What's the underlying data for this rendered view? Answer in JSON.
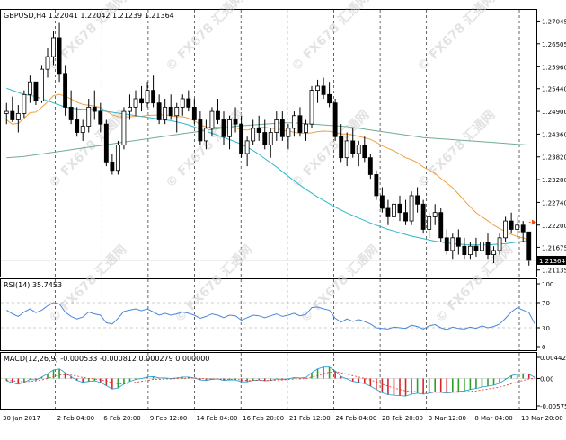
{
  "chart_data": {
    "type": "candlestick",
    "main": {
      "label": "GBPUSD,H4 1.22041 1.22042 1.21239 1.21364",
      "y_ticks": [
        1.27045,
        1.26505,
        1.2596,
        1.2544,
        1.249,
        1.2436,
        1.2382,
        1.2328,
        1.2274,
        1.222,
        1.21675,
        1.21135
      ],
      "ylim": [
        1.2098,
        1.2731
      ],
      "last_price_label": "1.21364",
      "last_price": 1.21364,
      "arrow_level": 1.2227,
      "ohlc": [
        [
          1.2485,
          1.251,
          1.246,
          1.249
        ],
        [
          1.249,
          1.2525,
          1.2465,
          1.247
        ],
        [
          1.247,
          1.2505,
          1.244,
          1.2485
        ],
        [
          1.2485,
          1.254,
          1.2475,
          1.253
        ],
        [
          1.253,
          1.2575,
          1.251,
          1.256
        ],
        [
          1.256,
          1.256,
          1.2505,
          1.2515
        ],
        [
          1.2515,
          1.26,
          1.251,
          1.259
        ],
        [
          1.259,
          1.264,
          1.257,
          1.262
        ],
        [
          1.262,
          1.268,
          1.26,
          1.2665
        ],
        [
          1.2665,
          1.27,
          1.256,
          1.258
        ],
        [
          1.258,
          1.26,
          1.248,
          1.25
        ],
        [
          1.25,
          1.254,
          1.246,
          1.247
        ],
        [
          1.247,
          1.25,
          1.243,
          1.244
        ],
        [
          1.244,
          1.247,
          1.242,
          1.2455
        ],
        [
          1.2455,
          1.252,
          1.244,
          1.25
        ],
        [
          1.25,
          1.254,
          1.247,
          1.249
        ],
        [
          1.249,
          1.251,
          1.244,
          1.246
        ],
        [
          1.246,
          1.247,
          1.236,
          1.237
        ],
        [
          1.237,
          1.239,
          1.234,
          1.235
        ],
        [
          1.235,
          1.242,
          1.234,
          1.241
        ],
        [
          1.241,
          1.25,
          1.24,
          1.249
        ],
        [
          1.249,
          1.253,
          1.247,
          1.25
        ],
        [
          1.25,
          1.254,
          1.248,
          1.252
        ],
        [
          1.252,
          1.255,
          1.249,
          1.251
        ],
        [
          1.251,
          1.256,
          1.25,
          1.254
        ],
        [
          1.254,
          1.2575,
          1.25,
          1.251
        ],
        [
          1.251,
          1.253,
          1.246,
          1.247
        ],
        [
          1.247,
          1.252,
          1.246,
          1.25
        ],
        [
          1.25,
          1.253,
          1.247,
          1.248
        ],
        [
          1.248,
          1.251,
          1.244,
          1.25
        ],
        [
          1.25,
          1.253,
          1.248,
          1.252
        ],
        [
          1.252,
          1.254,
          1.249,
          1.25
        ],
        [
          1.25,
          1.252,
          1.246,
          1.247
        ],
        [
          1.247,
          1.249,
          1.241,
          1.242
        ],
        [
          1.242,
          1.247,
          1.24,
          1.245
        ],
        [
          1.245,
          1.25,
          1.243,
          1.249
        ],
        [
          1.249,
          1.252,
          1.246,
          1.247
        ],
        [
          1.247,
          1.249,
          1.241,
          1.243
        ],
        [
          1.243,
          1.248,
          1.24,
          1.247
        ],
        [
          1.247,
          1.25,
          1.244,
          1.246
        ],
        [
          1.246,
          1.248,
          1.238,
          1.239
        ],
        [
          1.239,
          1.243,
          1.236,
          1.242
        ],
        [
          1.242,
          1.247,
          1.241,
          1.245
        ],
        [
          1.245,
          1.248,
          1.242,
          1.244
        ],
        [
          1.244,
          1.247,
          1.24,
          1.241
        ],
        [
          1.241,
          1.245,
          1.238,
          1.244
        ],
        [
          1.244,
          1.249,
          1.242,
          1.247
        ],
        [
          1.247,
          1.249,
          1.242,
          1.243
        ],
        [
          1.243,
          1.246,
          1.24,
          1.245
        ],
        [
          1.245,
          1.249,
          1.243,
          1.248
        ],
        [
          1.248,
          1.25,
          1.243,
          1.244
        ],
        [
          1.244,
          1.247,
          1.242,
          1.246
        ],
        [
          1.246,
          1.255,
          1.245,
          1.254
        ],
        [
          1.254,
          1.2565,
          1.251,
          1.255
        ],
        [
          1.255,
          1.257,
          1.252,
          1.253
        ],
        [
          1.253,
          1.256,
          1.25,
          1.251
        ],
        [
          1.251,
          1.252,
          1.242,
          1.243
        ],
        [
          1.243,
          1.246,
          1.237,
          1.238
        ],
        [
          1.238,
          1.244,
          1.236,
          1.242
        ],
        [
          1.242,
          1.245,
          1.238,
          1.239
        ],
        [
          1.239,
          1.242,
          1.236,
          1.241
        ],
        [
          1.241,
          1.243,
          1.237,
          1.238
        ],
        [
          1.238,
          1.239,
          1.233,
          1.234
        ],
        [
          1.234,
          1.235,
          1.228,
          1.229
        ],
        [
          1.229,
          1.231,
          1.225,
          1.226
        ],
        [
          1.226,
          1.228,
          1.222,
          1.224
        ],
        [
          1.224,
          1.228,
          1.223,
          1.227
        ],
        [
          1.227,
          1.229,
          1.223,
          1.225
        ],
        [
          1.225,
          1.228,
          1.222,
          1.223
        ],
        [
          1.223,
          1.23,
          1.222,
          1.229
        ],
        [
          1.229,
          1.231,
          1.225,
          1.227
        ],
        [
          1.227,
          1.228,
          1.22,
          1.221
        ],
        [
          1.221,
          1.225,
          1.219,
          1.224
        ],
        [
          1.224,
          1.227,
          1.222,
          1.225
        ],
        [
          1.225,
          1.226,
          1.218,
          1.219
        ],
        [
          1.219,
          1.221,
          1.215,
          1.216
        ],
        [
          1.216,
          1.22,
          1.214,
          1.219
        ],
        [
          1.219,
          1.221,
          1.215,
          1.217
        ],
        [
          1.217,
          1.219,
          1.214,
          1.215
        ],
        [
          1.215,
          1.218,
          1.214,
          1.217
        ],
        [
          1.217,
          1.219,
          1.2145,
          1.216
        ],
        [
          1.216,
          1.219,
          1.215,
          1.218
        ],
        [
          1.218,
          1.22,
          1.214,
          1.215
        ],
        [
          1.215,
          1.217,
          1.213,
          1.216
        ],
        [
          1.216,
          1.22,
          1.215,
          1.219
        ],
        [
          1.219,
          1.224,
          1.218,
          1.223
        ],
        [
          1.223,
          1.225,
          1.22,
          1.221
        ],
        [
          1.221,
          1.224,
          1.219,
          1.222
        ],
        [
          1.222,
          1.223,
          1.218,
          1.2204
        ],
        [
          1.2204,
          1.2204,
          1.2124,
          1.2136
        ]
      ],
      "ma_fast": [
        1.2545,
        1.254,
        1.2535,
        1.253,
        1.2528,
        1.2525,
        1.252,
        1.2515,
        1.251,
        1.2505,
        1.25,
        1.2498,
        1.2496,
        1.2495,
        1.2495,
        1.2494,
        1.2492,
        1.249,
        1.2488,
        1.2486,
        1.2484,
        1.2482,
        1.248,
        1.2478,
        1.2476,
        1.2474,
        1.2472,
        1.247,
        1.2468,
        1.2465,
        1.2462,
        1.2458,
        1.2453,
        1.2448,
        1.2443,
        1.2438,
        1.2433,
        1.2428,
        1.2423,
        1.2418,
        1.2412,
        1.2405,
        1.2397,
        1.2388,
        1.2378,
        1.2368,
        1.2358,
        1.2347,
        1.2336,
        1.2325,
        1.2315,
        1.2305,
        1.2296,
        1.2287,
        1.2279,
        1.2271,
        1.2263,
        1.2256,
        1.2249,
        1.2243,
        1.2237,
        1.2231,
        1.2225,
        1.222,
        1.2215,
        1.221,
        1.2206,
        1.2202,
        1.2198,
        1.2194,
        1.2191,
        1.2188,
        1.2185,
        1.2182,
        1.218,
        1.2178,
        1.2176,
        1.2175,
        1.2174,
        1.2173,
        1.2173,
        1.2173,
        1.2173,
        1.2174,
        1.2175,
        1.2176,
        1.2178,
        1.218,
        1.2182,
        1.2184
      ],
      "ma_slow": [
        1.238,
        1.2381,
        1.2382,
        1.2383,
        1.2385,
        1.2387,
        1.2389,
        1.2391,
        1.2393,
        1.2395,
        1.2397,
        1.2399,
        1.2401,
        1.2403,
        1.2405,
        1.2407,
        1.2409,
        1.2411,
        1.2413,
        1.2415,
        1.2417,
        1.2419,
        1.2421,
        1.2423,
        1.2425,
        1.2427,
        1.2429,
        1.2431,
        1.2433,
        1.2435,
        1.2437,
        1.2439,
        1.2441,
        1.2443,
        1.2445,
        1.2447,
        1.2449,
        1.2451,
        1.2453,
        1.2455,
        1.2456,
        1.2457,
        1.2458,
        1.2459,
        1.246,
        1.2461,
        1.2462,
        1.2463,
        1.2463,
        1.2463,
        1.2462,
        1.2461,
        1.246,
        1.2459,
        1.2458,
        1.2457,
        1.2456,
        1.2455,
        1.2454,
        1.2452,
        1.245,
        1.2448,
        1.2446,
        1.2444,
        1.2442,
        1.244,
        1.2438,
        1.2436,
        1.2434,
        1.2432,
        1.243,
        1.2428,
        1.2427,
        1.2426,
        1.2425,
        1.2424,
        1.2423,
        1.2422,
        1.2421,
        1.242,
        1.2419,
        1.2418,
        1.2417,
        1.2416,
        1.2415,
        1.2414,
        1.2413,
        1.2412,
        1.2411,
        1.241
      ]
    },
    "rsi": {
      "label": "RSI(14) 35.7453",
      "ylim": [
        0,
        100
      ],
      "ticks": [
        100,
        70,
        30,
        0
      ],
      "levels": [
        70,
        30
      ],
      "values": [
        58,
        52,
        48,
        55,
        60,
        54,
        58,
        65,
        70,
        68,
        55,
        48,
        44,
        47,
        55,
        52,
        50,
        38,
        36,
        45,
        56,
        58,
        60,
        57,
        60,
        55,
        50,
        53,
        50,
        52,
        55,
        53,
        50,
        45,
        48,
        52,
        50,
        46,
        50,
        49,
        42,
        46,
        50,
        49,
        46,
        49,
        52,
        48,
        50,
        53,
        49,
        51,
        62,
        63,
        60,
        58,
        45,
        39,
        44,
        40,
        43,
        40,
        36,
        30,
        29,
        28,
        31,
        30,
        29,
        34,
        32,
        28,
        33,
        35,
        30,
        27,
        31,
        29,
        28,
        31,
        29,
        33,
        30,
        32,
        36,
        45,
        55,
        62,
        58,
        54,
        36
      ]
    },
    "macd": {
      "label": "MACD(12,26,9) -0.000533 -0.000812 0.000279 0.000000",
      "ylim": [
        -0.00575,
        0.00442
      ],
      "ticks": [
        0.00442,
        0.0,
        -0.00575
      ],
      "tick_labels": [
        "0.00442",
        "0.00",
        "-0.00575"
      ],
      "values": [
        -0.0005,
        -0.0009,
        -0.0012,
        -0.0008,
        -0.0002,
        -0.0003,
        0.0003,
        0.001,
        0.0018,
        0.002,
        0.0012,
        0.0004,
        -0.0004,
        -0.0008,
        -0.0006,
        -0.0005,
        -0.0008,
        -0.0015,
        -0.0022,
        -0.002,
        -0.0012,
        -0.0006,
        -0.0002,
        0.0,
        0.0003,
        0.0004,
        0.0001,
        0.0001,
        0.0,
        0.0001,
        0.0003,
        0.0003,
        0.0001,
        -0.0003,
        -0.0004,
        -0.0002,
        -0.0001,
        -0.0004,
        -0.0003,
        -0.0003,
        -0.0007,
        -0.0007,
        -0.0004,
        -0.0003,
        -0.0005,
        -0.0004,
        -0.0001,
        -0.0002,
        -0.0001,
        0.0002,
        0.0001,
        0.0002,
        0.0012,
        0.002,
        0.0024,
        0.0024,
        0.0016,
        0.0004,
        -0.0001,
        -0.0006,
        -0.0008,
        -0.0011,
        -0.0016,
        -0.0023,
        -0.003,
        -0.0034,
        -0.0035,
        -0.0036,
        -0.0037,
        -0.0033,
        -0.0031,
        -0.0033,
        -0.0031,
        -0.0028,
        -0.0029,
        -0.0031,
        -0.0029,
        -0.0027,
        -0.0026,
        -0.0023,
        -0.0021,
        -0.0018,
        -0.0016,
        -0.0014,
        -0.001,
        -0.0002,
        0.0006,
        0.0009,
        0.001,
        0.0009,
        0.0002
      ],
      "signal": [
        -0.0003,
        -0.0005,
        -0.0006,
        -0.0007,
        -0.0006,
        -0.0005,
        -0.0003,
        0.0,
        0.0004,
        0.0007,
        0.0008,
        0.0007,
        0.0005,
        0.0002,
        0.0,
        -0.0001,
        -0.0003,
        -0.0005,
        -0.0009,
        -0.0011,
        -0.0011,
        -0.001,
        -0.0008,
        -0.0006,
        -0.0004,
        -0.0002,
        -0.0002,
        -0.0001,
        -0.0001,
        0.0,
        0.0,
        0.0001,
        0.0001,
        0.0,
        -0.0001,
        -0.0001,
        -0.0001,
        -0.0002,
        -0.0002,
        -0.0002,
        -0.0003,
        -0.0004,
        -0.0004,
        -0.0004,
        -0.0004,
        -0.0004,
        -0.0003,
        -0.0003,
        -0.0002,
        -0.0001,
        -0.0001,
        0.0,
        0.0003,
        0.0006,
        0.001,
        0.0013,
        0.0014,
        0.0012,
        0.0009,
        0.0006,
        0.0003,
        0.0,
        -0.0003,
        -0.0007,
        -0.0012,
        -0.0016,
        -0.002,
        -0.0023,
        -0.0026,
        -0.0027,
        -0.0028,
        -0.0029,
        -0.0029,
        -0.0029,
        -0.0029,
        -0.0029,
        -0.0029,
        -0.0029,
        -0.0028,
        -0.0027,
        -0.0026,
        -0.0024,
        -0.0022,
        -0.002,
        -0.0018,
        -0.0015,
        -0.0011,
        -0.0007,
        -0.0004,
        -0.0001,
        0.0
      ]
    },
    "x_labels": [
      "30 Jan 2017",
      "2 Feb 04:00",
      "6 Feb 20:00",
      "9 Feb 12:00",
      "14 Feb 04:00",
      "16 Feb 20:00",
      "21 Feb 12:00",
      "24 Feb 04:00",
      "28 Feb 20:00",
      "3 Mar 12:00",
      "8 Mar 04:00",
      "10 Mar 20:00"
    ],
    "colors": {
      "candle": "#000000",
      "ma_fast": "#2fb7c9",
      "ma_slow": "#6fae8f",
      "ma_orange": "#f0a040",
      "rsi_line": "#4a86d8",
      "macd_up": "#2ca02c",
      "macd_down": "#d62728",
      "macd_line": "#1f9bd3",
      "signal_line": "#e0302b",
      "arrow": "#ff4500"
    },
    "watermarks": [
      "FX678 汇通网"
    ]
  }
}
